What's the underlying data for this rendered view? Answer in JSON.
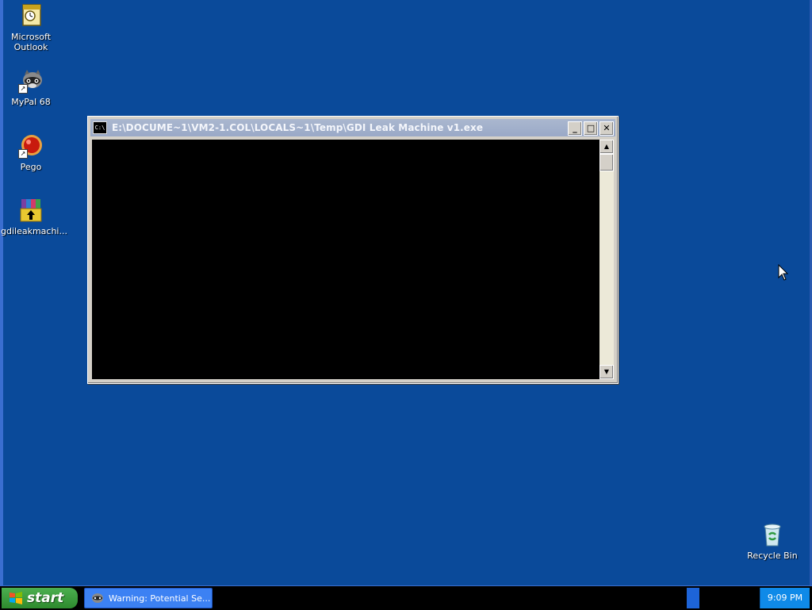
{
  "desktop": {
    "icons": [
      {
        "label": "Microsoft Outlook",
        "icon": "outlook-icon"
      },
      {
        "label": "MyPal 68",
        "icon": "mypal-raccoon-icon"
      },
      {
        "label": "Pego",
        "icon": "pego-ball-icon"
      },
      {
        "label": "gdileakmachi...",
        "icon": "winrar-archive-icon"
      },
      {
        "label": "Recycle Bin",
        "icon": "recycle-bin-icon"
      }
    ]
  },
  "console_window": {
    "title": "E:\\DOCUME~1\\VM2-1.COL\\LOCALS~1\\Temp\\GDI Leak Machine v1.exe",
    "icon_text": "C:\\",
    "buttons": {
      "minimize": "_",
      "maximize": "□",
      "close": "✕"
    }
  },
  "taskbar": {
    "start_label": "start",
    "task_items": [
      {
        "label": "Warning: Potential Se...",
        "icon": "mypal-raccoon-icon"
      }
    ],
    "clock": "9:09 PM"
  },
  "colors": {
    "desktop_bg": "#0a4a9a",
    "title_bar": "#9aa9c7",
    "console_bg": "#000000",
    "taskbar_bg": "#000000",
    "start_green": "#2e8b2e",
    "task_blue": "#3c81f3"
  }
}
